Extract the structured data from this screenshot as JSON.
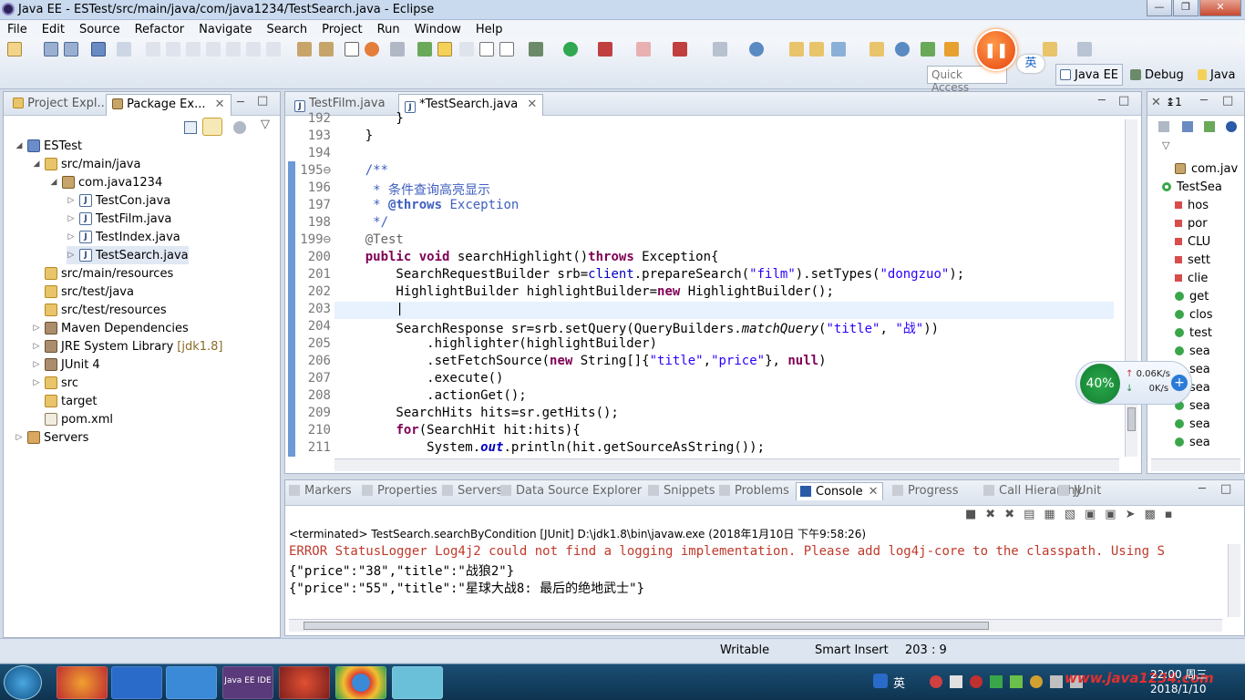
{
  "window": {
    "title": "Java EE - ESTest/src/main/java/com/java1234/TestSearch.java - Eclipse"
  },
  "menu": [
    "File",
    "Edit",
    "Source",
    "Refactor",
    "Navigate",
    "Search",
    "Project",
    "Run",
    "Window",
    "Help"
  ],
  "toolbar": {
    "quick_access": "Quick Access",
    "ime": "英",
    "perspectives": [
      "Java EE",
      "Debug",
      "Java"
    ]
  },
  "left_panel": {
    "tabs": [
      "Project Expl...",
      "Package Ex..."
    ],
    "tree": [
      {
        "label": "ESTest",
        "level": 0,
        "icon": "project-icon",
        "twisty": "◢"
      },
      {
        "label": "src/main/java",
        "level": 1,
        "icon": "source-folder-icon",
        "twisty": "◢"
      },
      {
        "label": "com.java1234",
        "level": 2,
        "icon": "package-icon",
        "twisty": "◢"
      },
      {
        "label": "TestCon.java",
        "level": 3,
        "icon": "java-file-icon",
        "twisty": "▷"
      },
      {
        "label": "TestFilm.java",
        "level": 3,
        "icon": "java-file-icon",
        "twisty": "▷"
      },
      {
        "label": "TestIndex.java",
        "level": 3,
        "icon": "java-file-icon",
        "twisty": "▷"
      },
      {
        "label": "TestSearch.java",
        "level": 3,
        "icon": "java-file-icon",
        "twisty": "▷",
        "selected": true
      },
      {
        "label": "src/main/resources",
        "level": 1,
        "icon": "source-folder-icon",
        "twisty": ""
      },
      {
        "label": "src/test/java",
        "level": 1,
        "icon": "source-folder-icon",
        "twisty": ""
      },
      {
        "label": "src/test/resources",
        "level": 1,
        "icon": "source-folder-icon",
        "twisty": ""
      },
      {
        "label": "Maven Dependencies",
        "level": 1,
        "icon": "library-icon",
        "twisty": "▷"
      },
      {
        "label": "JRE System Library",
        "suffix": "[jdk1.8]",
        "level": 1,
        "icon": "library-icon",
        "twisty": "▷"
      },
      {
        "label": "JUnit 4",
        "level": 1,
        "icon": "library-icon",
        "twisty": "▷"
      },
      {
        "label": "src",
        "level": 1,
        "icon": "folder-icon",
        "twisty": "▷"
      },
      {
        "label": "target",
        "level": 1,
        "icon": "folder-icon",
        "twisty": ""
      },
      {
        "label": "pom.xml",
        "level": 1,
        "icon": "xml-file-icon",
        "twisty": ""
      },
      {
        "label": "Servers",
        "level": 0,
        "icon": "servers-folder-icon",
        "twisty": "▷"
      }
    ]
  },
  "editor": {
    "tabs": [
      {
        "label": "TestFilm.java"
      },
      {
        "label": "*TestSearch.java",
        "active": true
      }
    ],
    "lines": [
      {
        "n": "192",
        "html": "        }"
      },
      {
        "n": "193",
        "html": "    }"
      },
      {
        "n": "194",
        "html": ""
      },
      {
        "n": "195⊖",
        "html": "    <span class='cmt'>/**</span>"
      },
      {
        "n": "196",
        "html": "<span class='cmt'>     * 条件查询高亮显示</span>"
      },
      {
        "n": "197",
        "html": "<span class='cmt'>     * <b>@throws</b> Exception</span>"
      },
      {
        "n": "198",
        "html": "<span class='cmt'>     */</span>"
      },
      {
        "n": "199⊖",
        "html": "    <span class='ann'>@Test</span>"
      },
      {
        "n": "200",
        "html": "    <span class='kw'>public</span> <span class='kw'>void</span> searchHighlight()<span class='kw'>throws</span> Exception{"
      },
      {
        "n": "201",
        "html": "        SearchRequestBuilder srb=<span class='fld'>client</span>.prepareSearch(<span class='str'>\"film\"</span>).setTypes(<span class='str'>\"dongzuo\"</span>);"
      },
      {
        "n": "202",
        "html": "        HighlightBuilder highlightBuilder=<span class='kw'>new</span> HighlightBuilder();"
      },
      {
        "n": "203",
        "html": "        |",
        "cursor": true
      },
      {
        "n": "204",
        "html": "        SearchResponse sr=srb.setQuery(QueryBuilders.<span class='it'>matchQuery</span>(<span class='str'>\"title\"</span>, <span class='str'>\"战\"</span>))"
      },
      {
        "n": "205",
        "html": "            .highlighter(highlightBuilder)"
      },
      {
        "n": "206",
        "html": "            .setFetchSource(<span class='kw'>new</span> String[]{<span class='str'>\"title\"</span>,<span class='str'>\"price\"</span>}, <span class='kw'>null</span>)"
      },
      {
        "n": "207",
        "html": "            .execute()"
      },
      {
        "n": "208",
        "html": "            .actionGet();"
      },
      {
        "n": "209",
        "html": "        SearchHits hits=sr.getHits();"
      },
      {
        "n": "210",
        "html": "        <span class='kw'>for</span>(SearchHit hit:hits){"
      },
      {
        "n": "211",
        "html": "            System.<span class='fld it'><b>out</b></span>.println(hit.getSourceAsString());"
      }
    ]
  },
  "outline": {
    "tab_label": "1",
    "items": [
      {
        "label": "com.jav",
        "kind": "import"
      },
      {
        "label": "TestSea",
        "kind": "class"
      },
      {
        "label": "hos",
        "kind": "field-s"
      },
      {
        "label": "por",
        "kind": "field-s"
      },
      {
        "label": "CLU",
        "kind": "field-sf"
      },
      {
        "label": "sett",
        "kind": "field-s"
      },
      {
        "label": "clie",
        "kind": "field"
      },
      {
        "label": "get",
        "kind": "method"
      },
      {
        "label": "clos",
        "kind": "method"
      },
      {
        "label": "test",
        "kind": "method"
      },
      {
        "label": "sea",
        "kind": "method"
      },
      {
        "label": "sea",
        "kind": "method"
      },
      {
        "label": "sea",
        "kind": "method"
      },
      {
        "label": "sea",
        "kind": "method"
      },
      {
        "label": "sea",
        "kind": "method"
      },
      {
        "label": "sea",
        "kind": "method"
      }
    ]
  },
  "bottom": {
    "tabs": [
      "Markers",
      "Properties",
      "Servers",
      "Data Source Explorer",
      "Snippets",
      "Problems",
      "Console",
      "Progress",
      "Call Hierarchy",
      "JUnit"
    ],
    "active_tab": "Console",
    "terminated": "<terminated> TestSearch.searchByCondition [JUnit] D:\\jdk1.8\\bin\\javaw.exe (2018年1月10日 下午9:58:26)",
    "lines": [
      {
        "text": "ERROR StatusLogger Log4j2 could not find a logging implementation. Please add log4j-core to the classpath. Using S",
        "color": "#c0392b"
      },
      {
        "text": "{\"price\":\"38\",\"title\":\"战狼2\"}",
        "color": "#000000"
      },
      {
        "text": "{\"price\":\"55\",\"title\":\"星球大战8: 最后的绝地武士\"}",
        "color": "#000000"
      }
    ]
  },
  "status": {
    "writable": "Writable",
    "insert_mode": "Smart Insert",
    "position": "203 : 9"
  },
  "net_widget": {
    "cpu": "40%",
    "up": "0.06K/s",
    "down": "0K/s"
  },
  "taskbar": {
    "ime": "英",
    "watermark": "www.java1234.com",
    "time": "22:00 周三",
    "date": "2018/1/10",
    "app_label": "Java EE IDE"
  },
  "colors": {
    "keyword": "#7f0055",
    "string": "#2a00ff",
    "comment": "#3f5fbf",
    "error": "#c0392b"
  }
}
